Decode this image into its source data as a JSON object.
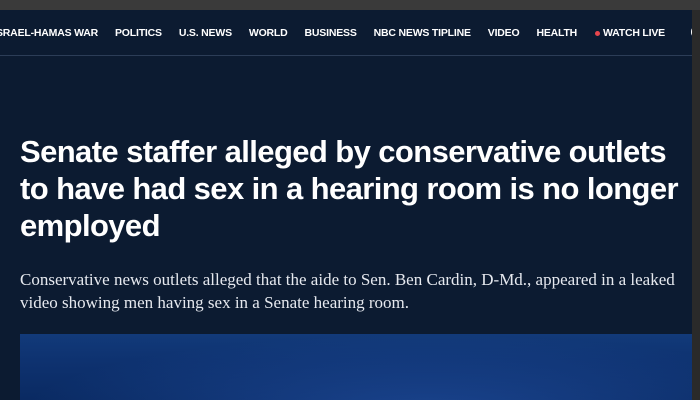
{
  "nav": {
    "items": [
      {
        "label": "SRAEL-HAMAS WAR"
      },
      {
        "label": "POLITICS"
      },
      {
        "label": "U.S. NEWS"
      },
      {
        "label": "WORLD"
      },
      {
        "label": "BUSINESS"
      },
      {
        "label": "NBC NEWS TIPLINE"
      },
      {
        "label": "VIDEO"
      },
      {
        "label": "HEALTH"
      }
    ],
    "watch_live_label": "WATCH LIVE",
    "search_icon": "search-icon"
  },
  "article": {
    "headline": "Senate staffer alleged by conservative outlets to have had sex in a hearing room is no longer employed",
    "dek": "Conservative news outlets alleged that the aide to Sen. Ben Cardin, D-Md., appeared in a leaked video showing men having sex in a Senate hearing room."
  },
  "colors": {
    "background": "#0c1b31",
    "live_dot": "#e8464d",
    "text": "#ffffff"
  }
}
